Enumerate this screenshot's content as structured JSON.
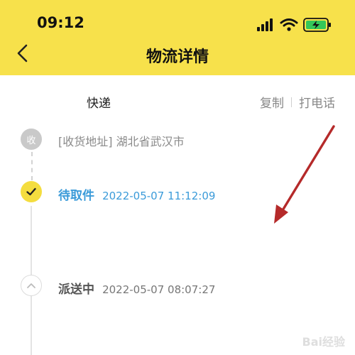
{
  "status_bar": {
    "time": "09:12",
    "icons": [
      "signal-icon",
      "wifi-icon",
      "battery-charging-icon"
    ]
  },
  "nav": {
    "title": "物流详情",
    "back_icon": "chevron-left-icon"
  },
  "header": {
    "courier_label": "快递",
    "copy_label": "复制",
    "call_label": "打电话"
  },
  "timeline": {
    "receive": {
      "badge": "收",
      "text": "[收货地址] 湖北省武汉市"
    },
    "pickup": {
      "status": "待取件",
      "time": "2022-05-07 11:12:09",
      "icon": "check-icon"
    },
    "deliver": {
      "status": "派送中",
      "time": "2022-05-07 08:07:27",
      "icon": "chevron-up-icon"
    }
  },
  "watermark": {
    "text": "Bai经验"
  },
  "colors": {
    "header_yellow": "#f7e14b",
    "accent_blue": "#3b9bd9",
    "dot_yellow": "#f4dd3f",
    "annotation_red": "#b52a2a"
  }
}
